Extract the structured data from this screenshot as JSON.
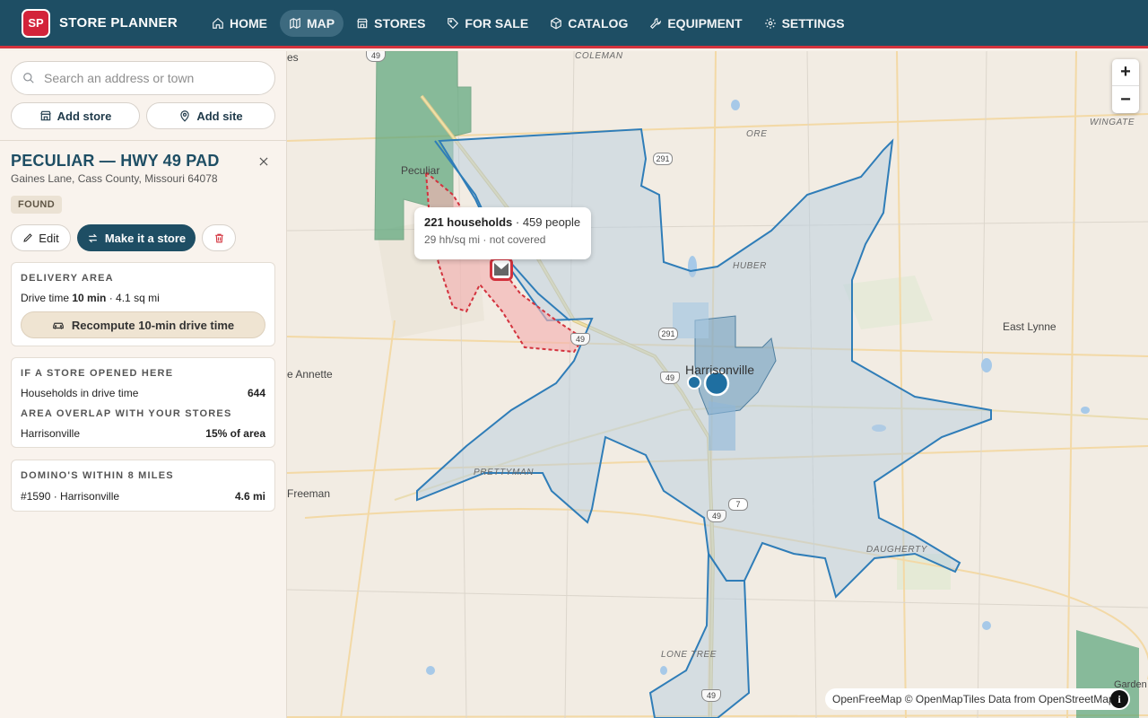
{
  "app": {
    "logo": "SP",
    "name": "STORE PLANNER"
  },
  "nav": [
    {
      "label": "HOME",
      "icon": "home-icon"
    },
    {
      "label": "MAP",
      "icon": "map-icon",
      "active": true
    },
    {
      "label": "STORES",
      "icon": "store-icon"
    },
    {
      "label": "FOR SALE",
      "icon": "tag-icon"
    },
    {
      "label": "CATALOG",
      "icon": "box-icon"
    },
    {
      "label": "EQUIPMENT",
      "icon": "wrench-icon"
    },
    {
      "label": "SETTINGS",
      "icon": "gear-icon"
    }
  ],
  "sidebar": {
    "search_placeholder": "Search an address or town",
    "add_store": "Add store",
    "add_site": "Add site",
    "site": {
      "title": "PECULIAR — HWY 49 PAD",
      "address": "Gaines Lane, Cass County, Missouri 64078",
      "status": "FOUND",
      "edit": "Edit",
      "make_store": "Make it a store"
    },
    "delivery": {
      "heading": "DELIVERY AREA",
      "drive_time_label": "Drive time",
      "drive_time_value": "10 min",
      "area": "· 4.1 sq mi",
      "recompute": "Recompute 10-min drive time"
    },
    "if_opened": {
      "heading": "IF A STORE OPENED HERE",
      "households_label": "Households in drive time",
      "households_value": "644",
      "overlap_heading": "AREA OVERLAP WITH YOUR STORES",
      "overlap_store": "Harrisonville",
      "overlap_value": "15% of area"
    },
    "dominos": {
      "heading": "DOMINO'S WITHIN 8 MILES",
      "store": "#1590 · Harrisonville",
      "distance": "4.6 mi"
    }
  },
  "map": {
    "tooltip": {
      "households": "221 households",
      "people": "· 459 people",
      "density": "29 hh/sq mi",
      "coverage": "· not covered"
    },
    "labels": {
      "coleman": "COLEMAN",
      "ore": "ORE",
      "wingate": "WINGATE",
      "huber": "HUBER",
      "prettyman": "PRETTYMAN",
      "daugherty": "DAUGHERTY",
      "lone_tree": "LONE TREE",
      "peculiar": "Peculiar",
      "harrisonville": "Harrisonville",
      "east_lynne": "East Lynne",
      "annette": "e Annette",
      "freeman": "Freeman",
      "garden": "Garden Ci",
      "es": "es"
    },
    "shields": {
      "r49a": "49",
      "r291a": "291",
      "r291b": "291",
      "r49b": "49",
      "r7": "7",
      "r49c": "49",
      "r49d": "49",
      "r49e": "49"
    },
    "attribution": {
      "ofm": "OpenFreeMap",
      "omt": "© OpenMapTiles",
      "data": "Data from",
      "osm": "OpenStreetMap",
      "info": "i"
    },
    "zoom_in": "+",
    "zoom_out": "−"
  },
  "colors": {
    "brand": "#1e4e64",
    "accent": "#d3323d",
    "coverage": "#2f7db8",
    "green": "#5aa57a"
  }
}
